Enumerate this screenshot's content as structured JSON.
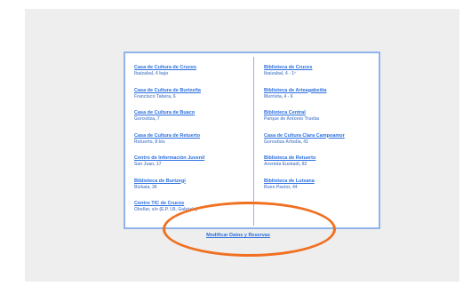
{
  "left_column": [
    {
      "name": "Casa de Cultura de Cruces",
      "address": "Ibaizabal, 4 bajo"
    },
    {
      "name": "Casa de Cultura de Burtzeña",
      "address": "Francisco Tabera, 6"
    },
    {
      "name": "Casa de Cultura de Buaco",
      "address": "Gorostiza, 7"
    },
    {
      "name": "Casa de Cultura de Retuerto",
      "address": "Retuerto, 8 bis"
    },
    {
      "name": "Centro de Información Juvenil",
      "address": "San Juan, 17"
    },
    {
      "name": "Biblioteca de Burtzegi",
      "address": "Bizkaia, 36"
    },
    {
      "name": "Centro TIC de Cruces",
      "address": "Obellar, s/n (E.P. I.B. Gabriela)"
    }
  ],
  "right_column": [
    {
      "name": "Biblioteca de Cruces",
      "address": "Ibaizabal, 4 - 1º"
    },
    {
      "name": "Biblioteca de Arteagabeitia",
      "address": "Murrieta, 4 - 6"
    },
    {
      "name": "Biblioteca Central",
      "address": "Parque de Antonio Trueba"
    },
    {
      "name": "Casa de Cultura Clara Campoamor",
      "address": "Gorostiza Arbolia, 41"
    },
    {
      "name": "Biblioteca de Retuerto",
      "address": "Avenida Euskadi, 92"
    },
    {
      "name": "Biblioteca de Lutxana",
      "address": "Ruen Pastor, 44"
    }
  ],
  "modify_link": "Modificar Datos y Reservas",
  "colors": {
    "link": "#2a6fe0",
    "border": "#8fb3ea",
    "highlight": "#f07020",
    "background": "#eeeeee"
  }
}
